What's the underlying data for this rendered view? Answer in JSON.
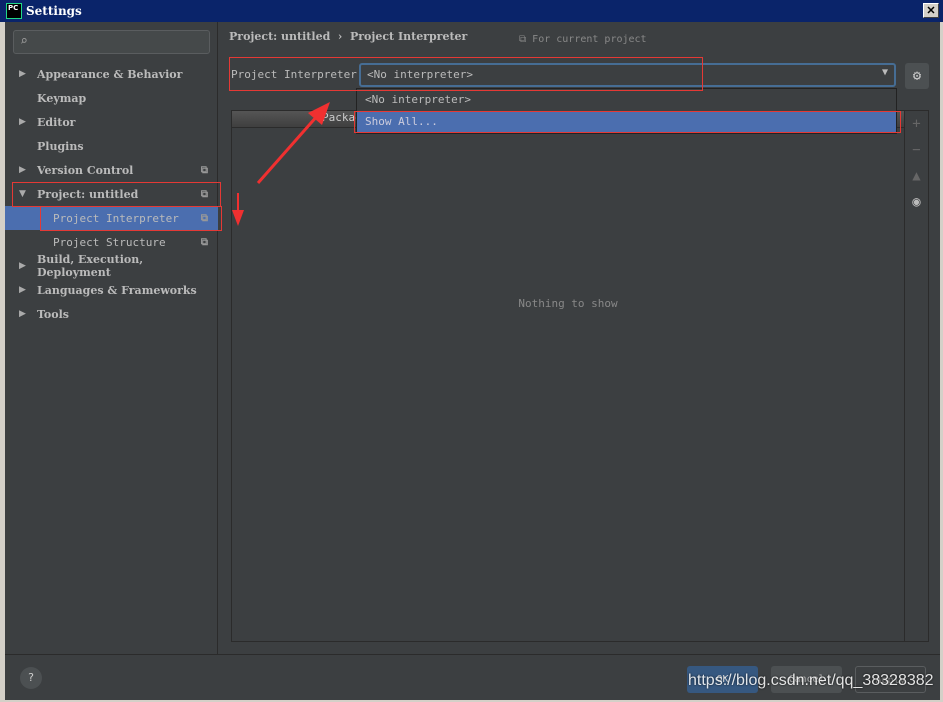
{
  "window": {
    "title": "Settings",
    "logo": "PC",
    "close": "✕"
  },
  "sidebar": {
    "search_placeholder": "",
    "items": [
      {
        "label": "Appearance & Behavior",
        "arrow": "▶"
      },
      {
        "label": "Keymap",
        "arrow": ""
      },
      {
        "label": "Editor",
        "arrow": "▶"
      },
      {
        "label": "Plugins",
        "arrow": ""
      },
      {
        "label": "Version Control",
        "arrow": "▶"
      },
      {
        "label": "Project: untitled",
        "arrow": "▼"
      },
      {
        "label": "Project Interpreter",
        "arrow": ""
      },
      {
        "label": "Project Structure",
        "arrow": ""
      },
      {
        "label": "Build, Execution, Deployment",
        "arrow": "▶"
      },
      {
        "label": "Languages & Frameworks",
        "arrow": "▶"
      },
      {
        "label": "Tools",
        "arrow": "▶"
      }
    ]
  },
  "main": {
    "breadcrumb": "Project: untitled  ›  Project Interpreter",
    "for_current": "For current project",
    "interpreter_label": "Project Interpreter:",
    "interpreter_value": "<No interpreter>",
    "dropdown_options": [
      "<No interpreter>",
      "Show All..."
    ],
    "table_header": "Package",
    "empty_text": "Nothing to show"
  },
  "footer": {
    "help": "?",
    "ok": "OK",
    "cancel": "Cancel",
    "apply": "Apply"
  },
  "watermark": "https://blog.csdn.net/qq_38328382",
  "colors": {
    "selection": "#4b6eaf",
    "annotation": "#e53935",
    "background": "#3c3f41"
  }
}
